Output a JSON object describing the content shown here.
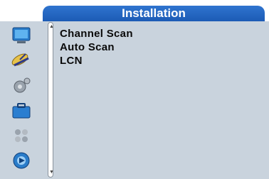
{
  "header": {
    "title": "Installation"
  },
  "menu": {
    "items": [
      {
        "label": "Channel Scan"
      },
      {
        "label": "Auto Scan"
      },
      {
        "label": "LCN"
      }
    ]
  },
  "sidebar": {
    "icons": [
      "tv-icon",
      "satellite-dish-icon",
      "gear-settings-icon",
      "toolbox-icon",
      "games-icon",
      "media-disc-icon"
    ]
  },
  "colors": {
    "title_bar": "#1c5bb5",
    "background": "#c9d3dd",
    "text": "#0a0a0a"
  }
}
